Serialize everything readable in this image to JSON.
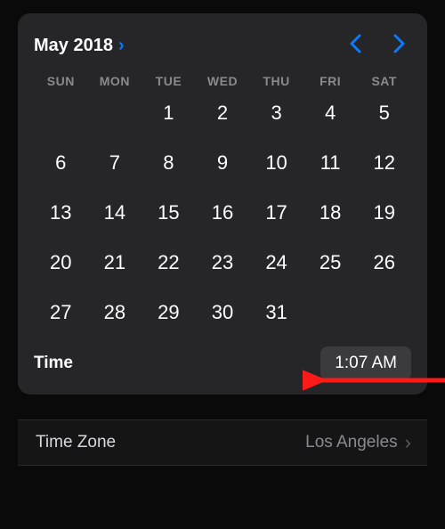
{
  "header": {
    "month_year": "May 2018"
  },
  "weekdays": [
    "SUN",
    "MON",
    "TUE",
    "WED",
    "THU",
    "FRI",
    "SAT"
  ],
  "days": {
    "leading_blanks": 2,
    "count": 31
  },
  "time": {
    "label": "Time",
    "value": "1:07 AM"
  },
  "timezone": {
    "label": "Time Zone",
    "value": "Los Angeles"
  }
}
